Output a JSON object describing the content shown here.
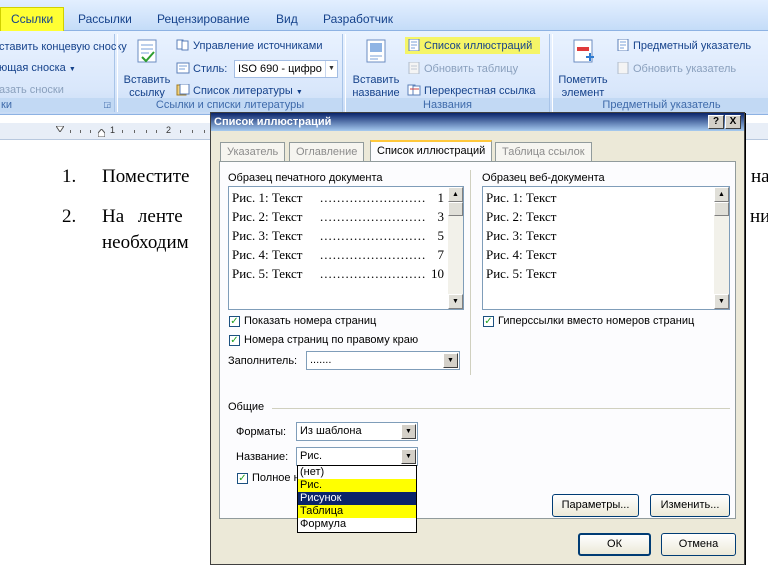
{
  "ribbon": {
    "tabs": [
      "Ссылки",
      "Рассылки",
      "Рецензирование",
      "Вид",
      "Разработчик"
    ],
    "footnotes": {
      "insert_endnote": "ставить концевую сноску",
      "next_footnote": "ющая сноска",
      "show_notes": "азать сноски",
      "group_label": "ки"
    },
    "citations": {
      "insert_citation": "Вставить ссылку",
      "manage_sources": "Управление источниками",
      "style_label": "Стиль:",
      "style_value": "ISO 690 - цифро",
      "bibliography": "Список литературы",
      "group_label": "Ссылки и списки литературы"
    },
    "captions": {
      "insert_caption": "Вставить название",
      "table_of_figures": "Список иллюстраций",
      "update_table": "Обновить таблицу",
      "cross_reference": "Перекрестная ссылка",
      "group_label": "Названия"
    },
    "index": {
      "mark_entry": "Пометить элемент",
      "insert_index": "Предметный указатель",
      "update_index": "Обновить указатель",
      "group_label": "Предметный указатель"
    }
  },
  "ruler": {
    "numbers": [
      "1",
      "2"
    ]
  },
  "document": {
    "item1_num": "1.",
    "item1_text": "Поместите",
    "item1_tail": "на",
    "item2_num": "2.",
    "item2_text": "На ленте",
    "item2_tail": "ни",
    "item2_cont": "необходим"
  },
  "dialog": {
    "title": "Список иллюстраций",
    "help_btn": "?",
    "close_btn": "X",
    "tabs": [
      "Указатель",
      "Оглавление",
      "Список иллюстраций",
      "Таблица ссылок"
    ],
    "print_preview_label": "Образец печатного документа",
    "print_preview": [
      {
        "text": "Рис. 1: Текст",
        "page": "1"
      },
      {
        "text": "Рис. 2: Текст",
        "page": "3"
      },
      {
        "text": "Рис. 3: Текст",
        "page": "5"
      },
      {
        "text": "Рис. 4: Текст",
        "page": "7"
      },
      {
        "text": "Рис. 5: Текст",
        "page": "10"
      }
    ],
    "web_preview_label": "Образец веб-документа",
    "web_preview": [
      "Рис. 1: Текст",
      "Рис. 2: Текст",
      "Рис. 3: Текст",
      "Рис. 4: Текст",
      "Рис. 5: Текст"
    ],
    "show_page_numbers": "Показать номера страниц",
    "right_align": "Номера страниц по правому краю",
    "hyperlinks": "Гиперссылки вместо номеров страниц",
    "leader_label": "Заполнитель:",
    "leader_value": ".......",
    "general_label": "Общие",
    "formats_label": "Форматы:",
    "formats_value": "Из шаблона",
    "caption_label": "Название:",
    "caption_value": "Рис.",
    "full_caption": "Полное н",
    "caption_options": [
      "(нет)",
      "Рис.",
      "Рисунок",
      "Таблица",
      "Формула"
    ],
    "options_btn": "Параметры...",
    "modify_btn": "Изменить...",
    "ok_btn": "ОК",
    "cancel_btn": "Отмена"
  },
  "colors": {
    "highlight": "#ffff00",
    "selection": "#0a246a",
    "title_bar": "#0a246a"
  }
}
